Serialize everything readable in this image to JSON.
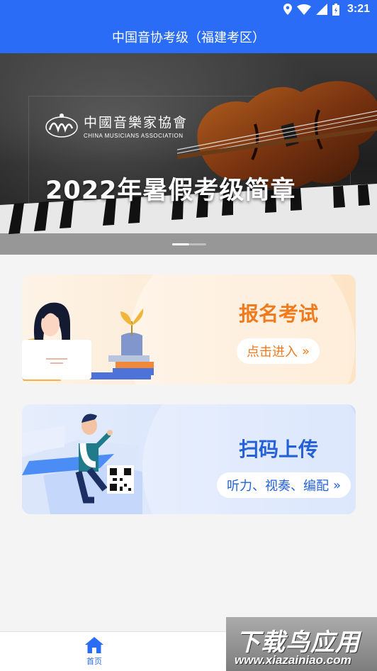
{
  "status_bar": {
    "time": "3:21",
    "icons": [
      "location-icon",
      "wifi-icon",
      "signal-icon",
      "battery-icon"
    ]
  },
  "header": {
    "title": "中国音协考级（福建考区）"
  },
  "banner": {
    "logo_cn": "中國音樂家協會",
    "logo_en": "CHINA MUSICIANS ASSOCIATION",
    "headline": "2022年暑假考级简章",
    "slide_count": 2,
    "active_slide": 1
  },
  "cards": {
    "exam": {
      "title": "报名考试",
      "button": "点击进入",
      "accent": "#f07a1c"
    },
    "upload": {
      "title": "扫码上传",
      "button": "听力、视奏、编配",
      "accent": "#2461d9"
    }
  },
  "tabbar": {
    "home_label": "首页",
    "accent": "#2a6cf5"
  },
  "watermark": {
    "cn": "下载鸟应用",
    "en": "www.xiazainiao.com"
  }
}
